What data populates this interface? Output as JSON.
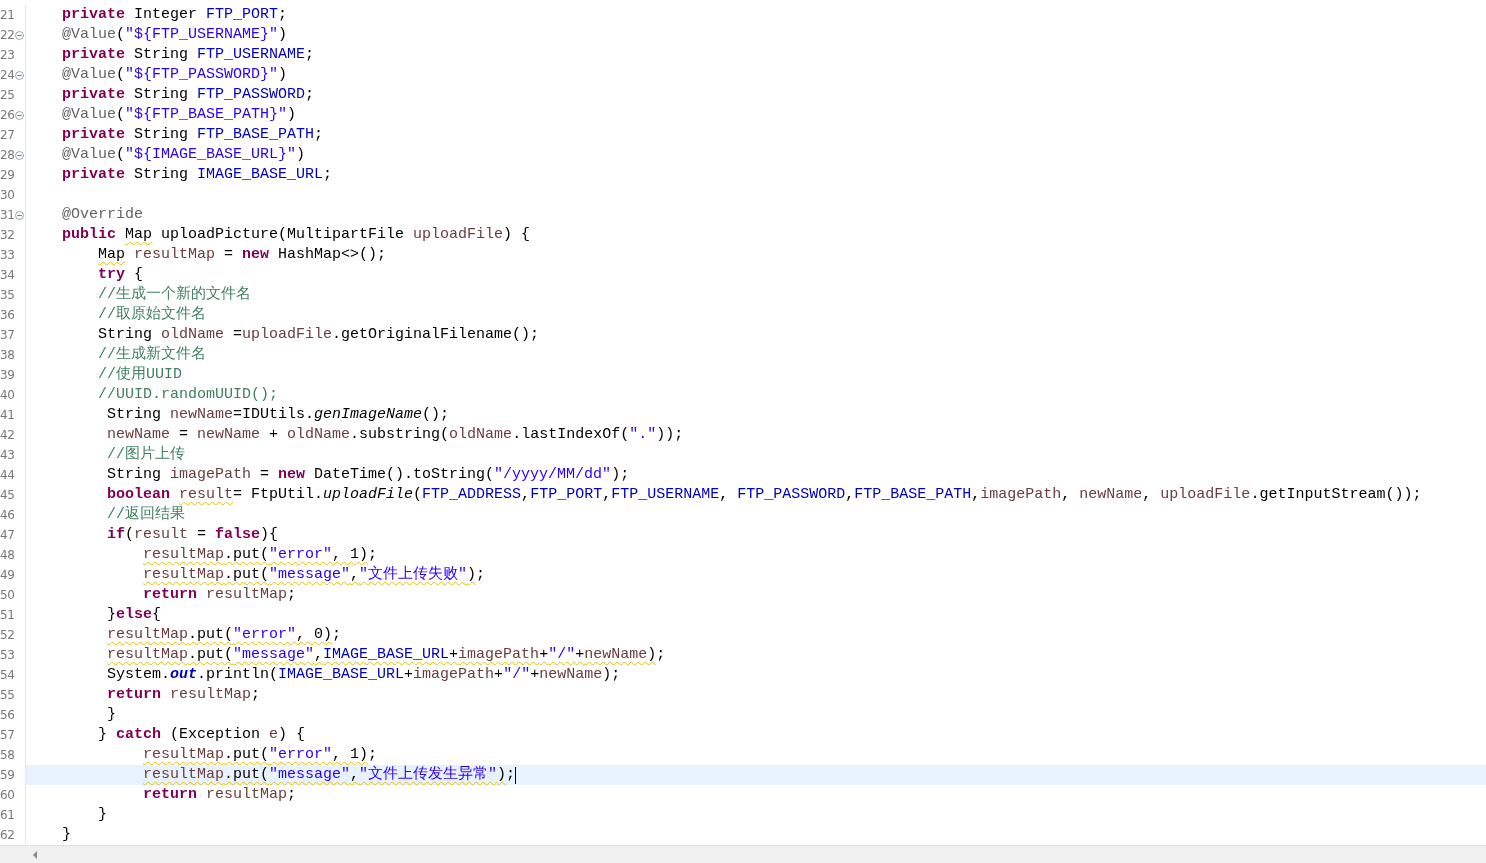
{
  "editor": {
    "lines": [
      {
        "number": "21",
        "foldable": false,
        "current": false,
        "kind": "member",
        "tokens": [
          {
            "text": "private ",
            "kind": "kw",
            "warning": false
          },
          {
            "text": "Integer ",
            "kind": "plain",
            "warning": false
          },
          {
            "text": "FTP_PORT",
            "kind": "field",
            "warning": false
          },
          {
            "text": ";",
            "kind": "plain",
            "warning": false
          }
        ]
      },
      {
        "number": "22",
        "foldable": true,
        "current": false,
        "kind": "member",
        "tokens": [
          {
            "text": "@Value",
            "kind": "annot",
            "warning": false
          },
          {
            "text": "(",
            "kind": "plain",
            "warning": false
          },
          {
            "text": "\"${FTP_USERNAME}\"",
            "kind": "str",
            "warning": false
          },
          {
            "text": ")",
            "kind": "plain",
            "warning": false
          }
        ]
      },
      {
        "number": "23",
        "foldable": false,
        "current": false,
        "kind": "member",
        "tokens": [
          {
            "text": "private ",
            "kind": "kw",
            "warning": false
          },
          {
            "text": "String ",
            "kind": "plain",
            "warning": false
          },
          {
            "text": "FTP_USERNAME",
            "kind": "field",
            "warning": false
          },
          {
            "text": ";",
            "kind": "plain",
            "warning": false
          }
        ]
      },
      {
        "number": "24",
        "foldable": true,
        "current": false,
        "kind": "member",
        "tokens": [
          {
            "text": "@Value",
            "kind": "annot",
            "warning": false
          },
          {
            "text": "(",
            "kind": "plain",
            "warning": false
          },
          {
            "text": "\"${FTP_PASSWORD}\"",
            "kind": "str",
            "warning": false
          },
          {
            "text": ")",
            "kind": "plain",
            "warning": false
          }
        ]
      },
      {
        "number": "25",
        "foldable": false,
        "current": false,
        "kind": "member",
        "tokens": [
          {
            "text": "private ",
            "kind": "kw",
            "warning": false
          },
          {
            "text": "String ",
            "kind": "plain",
            "warning": false
          },
          {
            "text": "FTP_PASSWORD",
            "kind": "field",
            "warning": false
          },
          {
            "text": ";",
            "kind": "plain",
            "warning": false
          }
        ]
      },
      {
        "number": "26",
        "foldable": true,
        "current": false,
        "kind": "member",
        "tokens": [
          {
            "text": "@Value",
            "kind": "annot",
            "warning": false
          },
          {
            "text": "(",
            "kind": "plain",
            "warning": false
          },
          {
            "text": "\"${FTP_BASE_PATH}\"",
            "kind": "str",
            "warning": false
          },
          {
            "text": ")",
            "kind": "plain",
            "warning": false
          }
        ]
      },
      {
        "number": "27",
        "foldable": false,
        "current": false,
        "kind": "member",
        "tokens": [
          {
            "text": "private ",
            "kind": "kw",
            "warning": false
          },
          {
            "text": "String ",
            "kind": "plain",
            "warning": false
          },
          {
            "text": "FTP_BASE_PATH",
            "kind": "field",
            "warning": false
          },
          {
            "text": ";",
            "kind": "plain",
            "warning": false
          }
        ]
      },
      {
        "number": "28",
        "foldable": true,
        "current": false,
        "kind": "member",
        "tokens": [
          {
            "text": "@Value",
            "kind": "annot",
            "warning": false
          },
          {
            "text": "(",
            "kind": "plain",
            "warning": false
          },
          {
            "text": "\"${IMAGE_BASE_URL}\"",
            "kind": "str",
            "warning": false
          },
          {
            "text": ")",
            "kind": "plain",
            "warning": false
          }
        ]
      },
      {
        "number": "29",
        "foldable": false,
        "current": false,
        "kind": "member",
        "tokens": [
          {
            "text": "private ",
            "kind": "kw",
            "warning": false
          },
          {
            "text": "String ",
            "kind": "plain",
            "warning": false
          },
          {
            "text": "IMAGE_BASE_URL",
            "kind": "field",
            "warning": false
          },
          {
            "text": ";",
            "kind": "plain",
            "warning": false
          }
        ]
      },
      {
        "number": "30",
        "foldable": false,
        "current": false
      },
      {
        "number": "31",
        "foldable": true,
        "current": false,
        "kind": "member",
        "tokens": [
          {
            "text": "@Override",
            "kind": "annot",
            "warning": false
          }
        ]
      },
      {
        "number": "32",
        "foldable": false,
        "current": false,
        "kind": "member",
        "tokens": [
          {
            "text": "public ",
            "kind": "kw",
            "warning": false
          },
          {
            "text": "Map",
            "kind": "plain",
            "warning": true
          },
          {
            "text": " uploadPicture(MultipartFile ",
            "kind": "plain",
            "warning": false
          },
          {
            "text": "uploadFile",
            "kind": "local",
            "warning": false
          },
          {
            "text": ") {",
            "kind": "plain",
            "warning": false
          }
        ]
      },
      {
        "number": "33",
        "foldable": false,
        "current": false,
        "kind": "block",
        "tokens": [
          {
            "text": "Map",
            "kind": "plain",
            "warning": true
          },
          {
            "text": " resultMap",
            "kind": "local",
            "warning": false
          },
          {
            "text": " = ",
            "kind": "plain",
            "warning": false
          },
          {
            "text": "new",
            "kind": "kw",
            "warning": false
          },
          {
            "text": " HashMap<>();",
            "kind": "plain",
            "warning": false
          }
        ]
      },
      {
        "number": "34",
        "foldable": false,
        "current": false,
        "kind": "block",
        "tokens": [
          {
            "text": "try",
            "kind": "kw",
            "warning": false
          },
          {
            "text": " {",
            "kind": "plain",
            "warning": false
          }
        ]
      },
      {
        "number": "35",
        "foldable": false,
        "current": false,
        "kind": "block",
        "tokens": [
          {
            "text": "//生成一个新的文件名",
            "kind": "comment",
            "warning": false
          }
        ]
      },
      {
        "number": "36",
        "foldable": false,
        "current": false,
        "kind": "block",
        "tokens": [
          {
            "text": "//取原始文件名",
            "kind": "comment",
            "warning": false
          }
        ]
      },
      {
        "number": "37",
        "foldable": false,
        "current": false,
        "kind": "block",
        "tokens": [
          {
            "text": "String ",
            "kind": "plain",
            "warning": false
          },
          {
            "text": "oldName",
            "kind": "local",
            "warning": false
          },
          {
            "text": " =",
            "kind": "plain",
            "warning": false
          },
          {
            "text": "uploadFile",
            "kind": "local",
            "warning": false
          },
          {
            "text": ".getOriginalFilename();",
            "kind": "plain",
            "warning": false
          }
        ]
      },
      {
        "number": "38",
        "foldable": false,
        "current": false,
        "kind": "block",
        "tokens": [
          {
            "text": "//生成新文件名",
            "kind": "comment",
            "warning": false
          }
        ]
      },
      {
        "number": "39",
        "foldable": false,
        "current": false,
        "kind": "block",
        "tokens": [
          {
            "text": "//使用UUID",
            "kind": "comment",
            "warning": false
          }
        ]
      },
      {
        "number": "40",
        "foldable": false,
        "current": false,
        "kind": "block",
        "tokens": [
          {
            "text": "//UUID.randomUUID();",
            "kind": "comment",
            "warning": false
          }
        ]
      },
      {
        "number": "41",
        "foldable": false,
        "current": false,
        "kind": "block-offset",
        "tokens": [
          {
            "text": "String ",
            "kind": "plain",
            "warning": false
          },
          {
            "text": "newName",
            "kind": "local",
            "warning": false
          },
          {
            "text": "=IDUtils.",
            "kind": "plain",
            "warning": false
          },
          {
            "text": "genImageName",
            "kind": "smethod",
            "warning": false
          },
          {
            "text": "();",
            "kind": "plain",
            "warning": false
          }
        ]
      },
      {
        "number": "42",
        "foldable": false,
        "current": false,
        "kind": "block-offset",
        "tokens": [
          {
            "text": "newName",
            "kind": "local",
            "warning": false
          },
          {
            "text": " = ",
            "kind": "plain",
            "warning": false
          },
          {
            "text": "newName",
            "kind": "local",
            "warning": false
          },
          {
            "text": " + ",
            "kind": "plain",
            "warning": false
          },
          {
            "text": "oldName",
            "kind": "local",
            "warning": false
          },
          {
            "text": ".substring(",
            "kind": "plain",
            "warning": false
          },
          {
            "text": "oldName",
            "kind": "local",
            "warning": false
          },
          {
            "text": ".lastIndexOf(",
            "kind": "plain",
            "warning": false
          },
          {
            "text": "\".\"",
            "kind": "str",
            "warning": false
          },
          {
            "text": "));",
            "kind": "plain",
            "warning": false
          }
        ]
      },
      {
        "number": "43",
        "foldable": false,
        "current": false,
        "kind": "block-offset",
        "tokens": [
          {
            "text": "//图片上传",
            "kind": "comment",
            "warning": false
          }
        ]
      },
      {
        "number": "44",
        "foldable": false,
        "current": false,
        "kind": "block-offset",
        "tokens": [
          {
            "text": "String ",
            "kind": "plain",
            "warning": false
          },
          {
            "text": "imagePath",
            "kind": "local",
            "warning": false
          },
          {
            "text": " = ",
            "kind": "plain",
            "warning": false
          },
          {
            "text": "new",
            "kind": "kw",
            "warning": false
          },
          {
            "text": " DateTime().toString(",
            "kind": "plain",
            "warning": false
          },
          {
            "text": "\"/yyyy/MM/dd\"",
            "kind": "str",
            "warning": false
          },
          {
            "text": ");",
            "kind": "plain",
            "warning": false
          }
        ]
      },
      {
        "number": "45",
        "foldable": false,
        "current": false,
        "kind": "block-offset",
        "tokens": [
          {
            "text": "boolean ",
            "kind": "kw",
            "warning": false
          },
          {
            "text": "result",
            "kind": "local",
            "warning": true
          },
          {
            "text": "= FtpUtil.",
            "kind": "plain",
            "warning": false
          },
          {
            "text": "uploadFile",
            "kind": "smethod",
            "warning": false
          },
          {
            "text": "(",
            "kind": "plain",
            "warning": false
          },
          {
            "text": "FTP_ADDRESS",
            "kind": "field",
            "warning": false
          },
          {
            "text": ",",
            "kind": "plain",
            "warning": false
          },
          {
            "text": "FTP_PORT",
            "kind": "field",
            "warning": false
          },
          {
            "text": ",",
            "kind": "plain",
            "warning": false
          },
          {
            "text": "FTP_USERNAME",
            "kind": "field",
            "warning": false
          },
          {
            "text": ", ",
            "kind": "plain",
            "warning": false
          },
          {
            "text": "FTP_PASSWORD",
            "kind": "field",
            "warning": false
          },
          {
            "text": ",",
            "kind": "plain",
            "warning": false
          },
          {
            "text": "FTP_BASE_PATH",
            "kind": "field",
            "warning": false
          },
          {
            "text": ",",
            "kind": "plain",
            "warning": false
          },
          {
            "text": "imagePath",
            "kind": "local",
            "warning": false
          },
          {
            "text": ", ",
            "kind": "plain",
            "warning": false
          },
          {
            "text": "newName",
            "kind": "local",
            "warning": false
          },
          {
            "text": ", ",
            "kind": "plain",
            "warning": false
          },
          {
            "text": "uploadFile",
            "kind": "local",
            "warning": false
          },
          {
            "text": ".getInputStream());",
            "kind": "plain",
            "warning": false
          }
        ]
      },
      {
        "number": "46",
        "foldable": false,
        "current": false,
        "kind": "block-offset",
        "tokens": [
          {
            "text": "//返回结果",
            "kind": "comment",
            "warning": false
          }
        ]
      },
      {
        "number": "47",
        "foldable": false,
        "current": false,
        "kind": "block-offset",
        "tokens": [
          {
            "text": "if",
            "kind": "kw",
            "warning": false
          },
          {
            "text": "(",
            "kind": "plain",
            "warning": false
          },
          {
            "text": "result",
            "kind": "local",
            "warning": false
          },
          {
            "text": " = ",
            "kind": "plain",
            "warning": false
          },
          {
            "text": "false",
            "kind": "kw",
            "warning": false
          },
          {
            "text": "){",
            "kind": "plain",
            "warning": false
          }
        ]
      },
      {
        "number": "48",
        "foldable": false,
        "current": false,
        "kind": "nested-offset",
        "tokens": [
          {
            "text": "resultMap",
            "kind": "local",
            "warning": true
          },
          {
            "text": ".put(",
            "kind": "plain",
            "warning": true
          },
          {
            "text": "\"error\"",
            "kind": "str",
            "warning": true
          },
          {
            "text": ", 1)",
            "kind": "plain",
            "warning": true
          },
          {
            "text": ";",
            "kind": "plain",
            "warning": false
          }
        ]
      },
      {
        "number": "49",
        "foldable": false,
        "current": false,
        "kind": "nested-offset",
        "tokens": [
          {
            "text": "resultMap",
            "kind": "local",
            "warning": true
          },
          {
            "text": ".put(",
            "kind": "plain",
            "warning": true
          },
          {
            "text": "\"message\"",
            "kind": "str",
            "warning": true
          },
          {
            "text": ",",
            "kind": "plain",
            "warning": true
          },
          {
            "text": "\"文件上传失败\"",
            "kind": "str",
            "warning": true
          },
          {
            "text": ")",
            "kind": "plain",
            "warning": true
          },
          {
            "text": ";",
            "kind": "plain",
            "warning": false
          }
        ]
      },
      {
        "number": "50",
        "foldable": false,
        "current": false,
        "kind": "nested-offset",
        "tokens": [
          {
            "text": "return ",
            "kind": "kw",
            "warning": false
          },
          {
            "text": "resultMap",
            "kind": "local",
            "warning": false
          },
          {
            "text": ";",
            "kind": "plain",
            "warning": false
          }
        ]
      },
      {
        "number": "51",
        "foldable": false,
        "current": false,
        "kind": "block-offset",
        "tokens": [
          {
            "text": "}",
            "kind": "plain",
            "warning": false
          },
          {
            "text": "else",
            "kind": "kw",
            "warning": false
          },
          {
            "text": "{",
            "kind": "plain",
            "warning": false
          }
        ]
      },
      {
        "number": "52",
        "foldable": false,
        "current": false,
        "kind": "block-offset",
        "tokens": [
          {
            "text": "resultMap",
            "kind": "local",
            "warning": true
          },
          {
            "text": ".put(",
            "kind": "plain",
            "warning": true
          },
          {
            "text": "\"error\"",
            "kind": "str",
            "warning": true
          },
          {
            "text": ", 0)",
            "kind": "plain",
            "warning": true
          },
          {
            "text": ";",
            "kind": "plain",
            "warning": false
          }
        ]
      },
      {
        "number": "53",
        "foldable": false,
        "current": false,
        "kind": "block-offset",
        "tokens": [
          {
            "text": "resultMap",
            "kind": "local",
            "warning": true
          },
          {
            "text": ".put(",
            "kind": "plain",
            "warning": true
          },
          {
            "text": "\"message\"",
            "kind": "str",
            "warning": true
          },
          {
            "text": ",",
            "kind": "plain",
            "warning": true
          },
          {
            "text": "IMAGE_BASE_URL",
            "kind": "field",
            "warning": true
          },
          {
            "text": "+",
            "kind": "plain",
            "warning": true
          },
          {
            "text": "imagePath",
            "kind": "local",
            "warning": true
          },
          {
            "text": "+",
            "kind": "plain",
            "warning": true
          },
          {
            "text": "\"/\"",
            "kind": "str",
            "warning": true
          },
          {
            "text": "+",
            "kind": "plain",
            "warning": true
          },
          {
            "text": "newName",
            "kind": "local",
            "warning": true
          },
          {
            "text": ")",
            "kind": "plain",
            "warning": true
          },
          {
            "text": ";",
            "kind": "plain",
            "warning": false
          }
        ]
      },
      {
        "number": "54",
        "foldable": false,
        "current": false,
        "kind": "block-offset",
        "tokens": [
          {
            "text": "System.",
            "kind": "plain",
            "warning": false
          },
          {
            "text": "out",
            "kind": "sfield",
            "warning": false
          },
          {
            "text": ".println(",
            "kind": "plain",
            "warning": false
          },
          {
            "text": "IMAGE_BASE_URL",
            "kind": "field",
            "warning": false
          },
          {
            "text": "+",
            "kind": "plain",
            "warning": false
          },
          {
            "text": "imagePath",
            "kind": "local",
            "warning": false
          },
          {
            "text": "+",
            "kind": "plain",
            "warning": false
          },
          {
            "text": "\"/\"",
            "kind": "str",
            "warning": false
          },
          {
            "text": "+",
            "kind": "plain",
            "warning": false
          },
          {
            "text": "newName",
            "kind": "local",
            "warning": false
          },
          {
            "text": ");",
            "kind": "plain",
            "warning": false
          }
        ]
      },
      {
        "number": "55",
        "foldable": false,
        "current": false,
        "kind": "block-offset",
        "tokens": [
          {
            "text": "return ",
            "kind": "kw",
            "warning": false
          },
          {
            "text": "resultMap",
            "kind": "local",
            "warning": false
          },
          {
            "text": ";",
            "kind": "plain",
            "warning": false
          }
        ]
      },
      {
        "number": "56",
        "foldable": false,
        "current": false,
        "kind": "block-offset",
        "tokens": [
          {
            "text": "}",
            "kind": "plain",
            "warning": false
          }
        ]
      },
      {
        "number": "57",
        "foldable": false,
        "current": false,
        "kind": "block",
        "tokens": [
          {
            "text": "} ",
            "kind": "plain",
            "warning": false
          },
          {
            "text": "catch",
            "kind": "kw",
            "warning": false
          },
          {
            "text": " (Exception ",
            "kind": "plain",
            "warning": false
          },
          {
            "text": "e",
            "kind": "local",
            "warning": false
          },
          {
            "text": ") {",
            "kind": "plain",
            "warning": false
          }
        ]
      },
      {
        "number": "58",
        "foldable": false,
        "current": false,
        "kind": "nested-offset",
        "tokens": [
          {
            "text": "resultMap",
            "kind": "local",
            "warning": true
          },
          {
            "text": ".put(",
            "kind": "plain",
            "warning": true
          },
          {
            "text": "\"error\"",
            "kind": "str",
            "warning": true
          },
          {
            "text": ", 1)",
            "kind": "plain",
            "warning": true
          },
          {
            "text": ";",
            "kind": "plain",
            "warning": false
          }
        ]
      },
      {
        "number": "59",
        "foldable": false,
        "current": true,
        "kind": "nested-offset",
        "tokens": [
          {
            "text": "resultMap",
            "kind": "local",
            "warning": true
          },
          {
            "text": ".put(",
            "kind": "plain",
            "warning": true
          },
          {
            "text": "\"message\"",
            "kind": "str",
            "warning": true
          },
          {
            "text": ",",
            "kind": "plain",
            "warning": true
          },
          {
            "text": "\"文件上传发生异常\"",
            "kind": "str",
            "warning": true
          },
          {
            "text": ")",
            "kind": "plain",
            "warning": true
          },
          {
            "text": ";",
            "kind": "plain",
            "warning": false
          }
        ]
      },
      {
        "number": "60",
        "foldable": false,
        "current": false,
        "kind": "nested-offset",
        "tokens": [
          {
            "text": "return ",
            "kind": "kw",
            "warning": false
          },
          {
            "text": "resultMap",
            "kind": "local",
            "warning": false
          },
          {
            "text": ";",
            "kind": "plain",
            "warning": false
          }
        ]
      },
      {
        "number": "61",
        "foldable": false,
        "current": false,
        "kind": "block",
        "tokens": [
          {
            "text": "}",
            "kind": "plain",
            "warning": false
          }
        ]
      },
      {
        "number": "62",
        "foldable": false,
        "current": false,
        "kind": "member",
        "tokens": [
          {
            "text": "}",
            "kind": "plain",
            "warning": false
          }
        ]
      }
    ]
  }
}
